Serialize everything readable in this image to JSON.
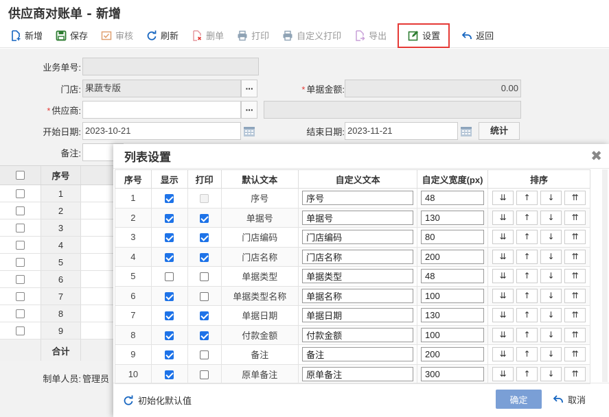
{
  "page": {
    "title": "供应商对账单 - 新增"
  },
  "toolbar": {
    "add": "新增",
    "save": "保存",
    "audit": "审核",
    "refresh": "刷新",
    "delete": "删单",
    "print": "打印",
    "custom_print": "自定义打印",
    "export": "导出",
    "settings": "设置",
    "back": "返回"
  },
  "form": {
    "business_no_label": "业务单号:",
    "business_no": "",
    "store_label": "门店:",
    "store": "果蔬专版",
    "amount_label": "单据金额:",
    "amount": "0.00",
    "supplier_label": "供应商:",
    "supplier": "",
    "start_date_label": "开始日期:",
    "start_date": "2023-10-21",
    "end_date_label": "结束日期:",
    "end_date": "2023-11-21",
    "stat_button": "统计",
    "remark_label": "备注:",
    "creator_label": "制单人员:",
    "creator": "管理员",
    "more_icon": "···"
  },
  "grid": {
    "seq_header": "序号",
    "rows": [
      "1",
      "2",
      "3",
      "4",
      "5",
      "6",
      "7",
      "8",
      "9"
    ],
    "total_label": "合计"
  },
  "modal": {
    "title": "列表设置",
    "headers": {
      "seq": "序号",
      "show": "显示",
      "print": "打印",
      "default_text": "默认文本",
      "custom_text": "自定义文本",
      "custom_width": "自定义宽度(px)",
      "sort": "排序"
    },
    "sort_buttons": {
      "top": "⇊",
      "up": "↑",
      "down": "↓",
      "bottom": "⇈"
    },
    "rows": [
      {
        "seq": "1",
        "show": true,
        "print": false,
        "print_disabled": true,
        "default": "序号",
        "custom": "序号",
        "width": "48"
      },
      {
        "seq": "2",
        "show": true,
        "print": true,
        "print_disabled": false,
        "default": "单据号",
        "custom": "单据号",
        "width": "130"
      },
      {
        "seq": "3",
        "show": true,
        "print": true,
        "print_disabled": false,
        "default": "门店编码",
        "custom": "门店编码",
        "width": "80"
      },
      {
        "seq": "4",
        "show": true,
        "print": true,
        "print_disabled": false,
        "default": "门店名称",
        "custom": "门店名称",
        "width": "200"
      },
      {
        "seq": "5",
        "show": false,
        "print": false,
        "print_disabled": false,
        "default": "单据类型",
        "custom": "单据类型",
        "width": "48"
      },
      {
        "seq": "6",
        "show": true,
        "print": false,
        "print_disabled": false,
        "default": "单据类型名称",
        "custom": "单据名称",
        "width": "100"
      },
      {
        "seq": "7",
        "show": true,
        "print": true,
        "print_disabled": false,
        "default": "单据日期",
        "custom": "单据日期",
        "width": "130"
      },
      {
        "seq": "8",
        "show": true,
        "print": true,
        "print_disabled": false,
        "default": "付款金额",
        "custom": "付款金额",
        "width": "100"
      },
      {
        "seq": "9",
        "show": true,
        "print": false,
        "print_disabled": false,
        "default": "备注",
        "custom": "备注",
        "width": "200"
      },
      {
        "seq": "10",
        "show": true,
        "print": false,
        "print_disabled": false,
        "default": "原单备注",
        "custom": "原单备注",
        "width": "300"
      }
    ],
    "reset_label": "初始化默认值",
    "ok_label": "确定",
    "cancel_label": "取消"
  },
  "colors": {
    "accent": "#1e73e8",
    "ok_button": "#7a9fd6",
    "highlight_border": "#e53935",
    "save_green": "#2e7d32"
  }
}
